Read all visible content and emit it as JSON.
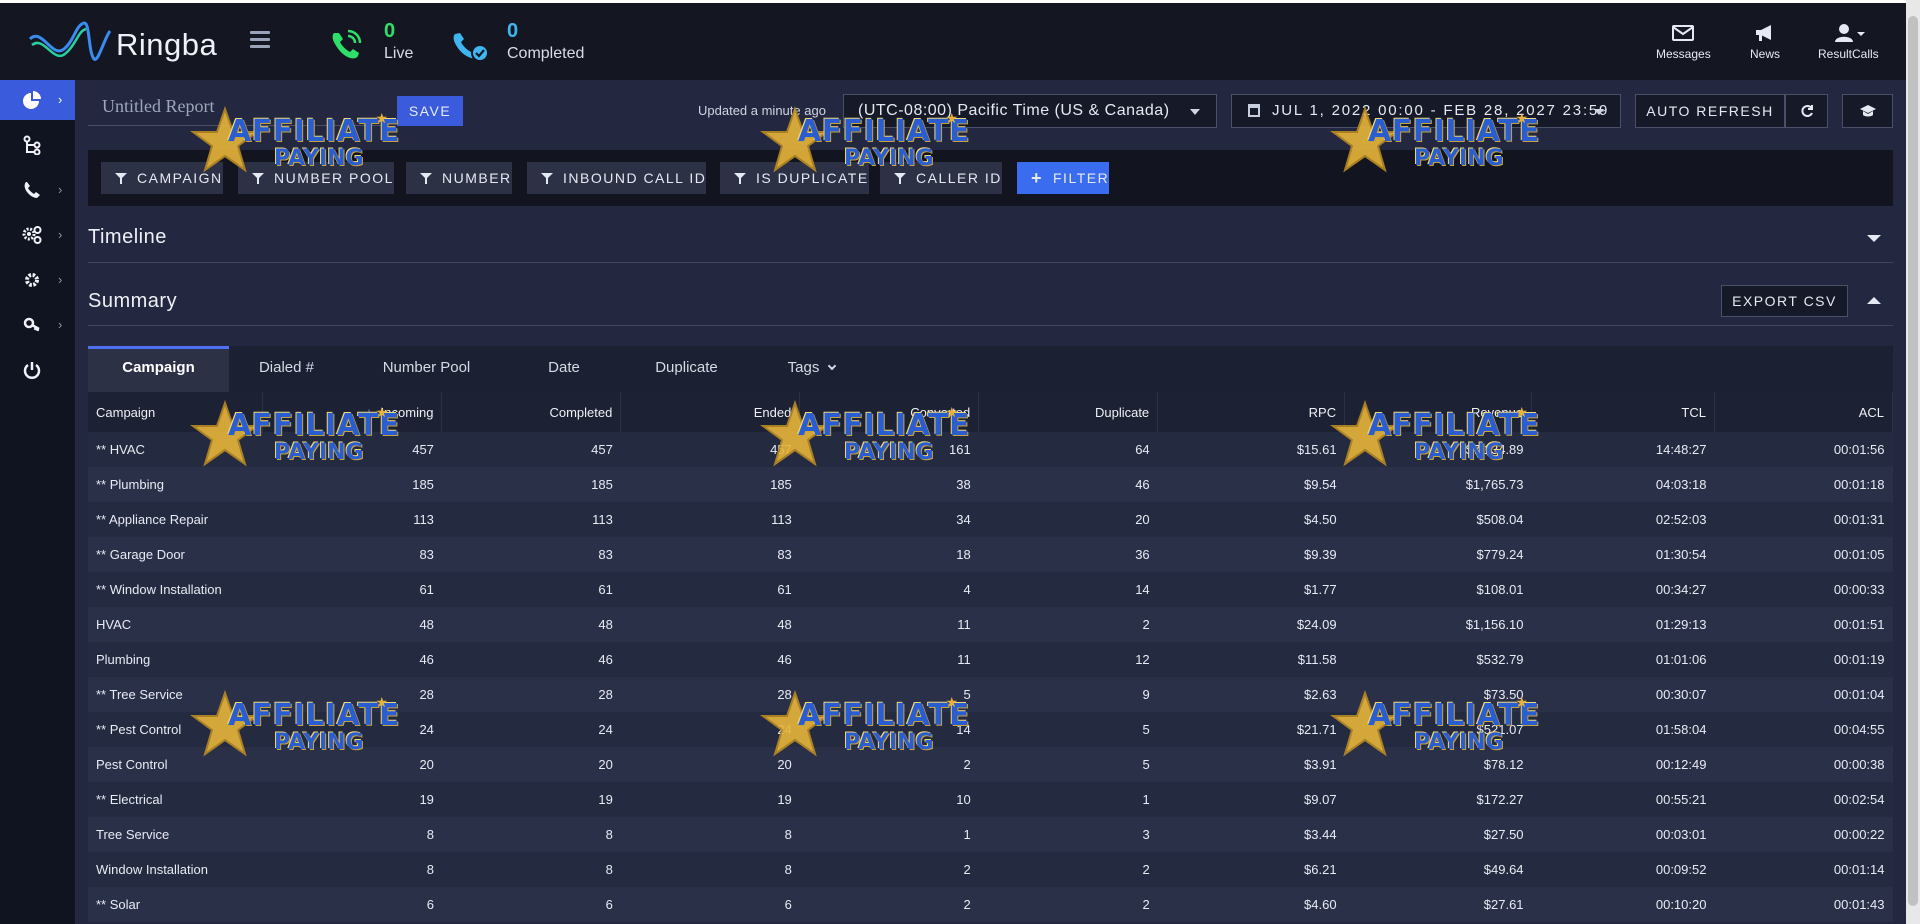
{
  "app": {
    "name": "Ringba"
  },
  "header": {
    "live_count": "0",
    "live_label": "Live",
    "completed_count": "0",
    "completed_label": "Completed",
    "links": [
      {
        "label": "Messages",
        "icon": "envelope-icon"
      },
      {
        "label": "News",
        "icon": "megaphone-icon"
      },
      {
        "label": "ResultCalls",
        "icon": "user-icon"
      }
    ]
  },
  "sidebar": {
    "items": [
      {
        "name": "dashboard",
        "icon": "pie-chart-icon",
        "active": true
      },
      {
        "name": "call-flows",
        "icon": "flow-icon"
      },
      {
        "name": "calls",
        "icon": "phone-icon"
      },
      {
        "name": "integrations",
        "icon": "cogs-icon"
      },
      {
        "name": "settings",
        "icon": "gear-icon"
      },
      {
        "name": "security",
        "icon": "key-icon"
      },
      {
        "name": "logout",
        "icon": "power-icon"
      }
    ]
  },
  "report": {
    "title_placeholder": "Untitled Report",
    "save_label": "SAVE",
    "updated": "Updated a minute ago",
    "timezone": "(UTC-08:00) Pacific Time (US & Canada)",
    "date_range": "JUL 1, 2022 00:00 - FEB 28, 2027 23:59",
    "auto_refresh_label": "AUTO REFRESH"
  },
  "filters": {
    "chips": [
      "CAMPAIGN",
      "NUMBER POOL",
      "NUMBER",
      "INBOUND CALL ID",
      "IS DUPLICATE",
      "CALLER ID"
    ],
    "add_label": "FILTER"
  },
  "sections": {
    "timeline": "Timeline",
    "summary": "Summary",
    "export_label": "EXPORT CSV"
  },
  "tabs": [
    "Campaign",
    "Dialed #",
    "Number Pool",
    "Date",
    "Duplicate",
    "Tags"
  ],
  "table": {
    "columns": [
      "Campaign",
      "Incoming",
      "Completed",
      "Ended",
      "Converted",
      "Duplicate",
      "RPC",
      "Revenue",
      "TCL",
      "ACL"
    ],
    "rows": [
      [
        "** HVAC",
        "457",
        "457",
        "457",
        "161",
        "64",
        "$15.61",
        "$7,134.89",
        "14:48:27",
        "00:01:56"
      ],
      [
        "** Plumbing",
        "185",
        "185",
        "185",
        "38",
        "46",
        "$9.54",
        "$1,765.73",
        "04:03:18",
        "00:01:18"
      ],
      [
        "** Appliance Repair",
        "113",
        "113",
        "113",
        "34",
        "20",
        "$4.50",
        "$508.04",
        "02:52:03",
        "00:01:31"
      ],
      [
        "** Garage Door",
        "83",
        "83",
        "83",
        "18",
        "36",
        "$9.39",
        "$779.24",
        "01:30:54",
        "00:01:05"
      ],
      [
        "** Window Installation",
        "61",
        "61",
        "61",
        "4",
        "14",
        "$1.77",
        "$108.01",
        "00:34:27",
        "00:00:33"
      ],
      [
        "HVAC",
        "48",
        "48",
        "48",
        "11",
        "2",
        "$24.09",
        "$1,156.10",
        "01:29:13",
        "00:01:51"
      ],
      [
        "Plumbing",
        "46",
        "46",
        "46",
        "11",
        "12",
        "$11.58",
        "$532.79",
        "01:01:06",
        "00:01:19"
      ],
      [
        "** Tree Service",
        "28",
        "28",
        "28",
        "5",
        "9",
        "$2.63",
        "$73.50",
        "00:30:07",
        "00:01:04"
      ],
      [
        "** Pest Control",
        "24",
        "24",
        "24",
        "14",
        "5",
        "$21.71",
        "$521.07",
        "01:58:04",
        "00:04:55"
      ],
      [
        "Pest Control",
        "20",
        "20",
        "20",
        "2",
        "5",
        "$3.91",
        "$78.12",
        "00:12:49",
        "00:00:38"
      ],
      [
        "** Electrical",
        "19",
        "19",
        "19",
        "10",
        "1",
        "$9.07",
        "$172.27",
        "00:55:21",
        "00:02:54"
      ],
      [
        "Tree Service",
        "8",
        "8",
        "8",
        "1",
        "3",
        "$3.44",
        "$27.50",
        "00:03:01",
        "00:00:22"
      ],
      [
        "Window Installation",
        "8",
        "8",
        "8",
        "2",
        "2",
        "$6.21",
        "$49.64",
        "00:09:52",
        "00:01:14"
      ],
      [
        "** Solar",
        "6",
        "6",
        "6",
        "2",
        "2",
        "$4.60",
        "$27.61",
        "00:10:20",
        "00:01:43"
      ]
    ]
  },
  "watermark": {
    "line1": "AFFILIATE",
    "line2": "PAYING"
  },
  "colors": {
    "accent": "#3a5bdc",
    "live": "#2ee069",
    "completed": "#3fb6f0",
    "background": "#232840"
  }
}
